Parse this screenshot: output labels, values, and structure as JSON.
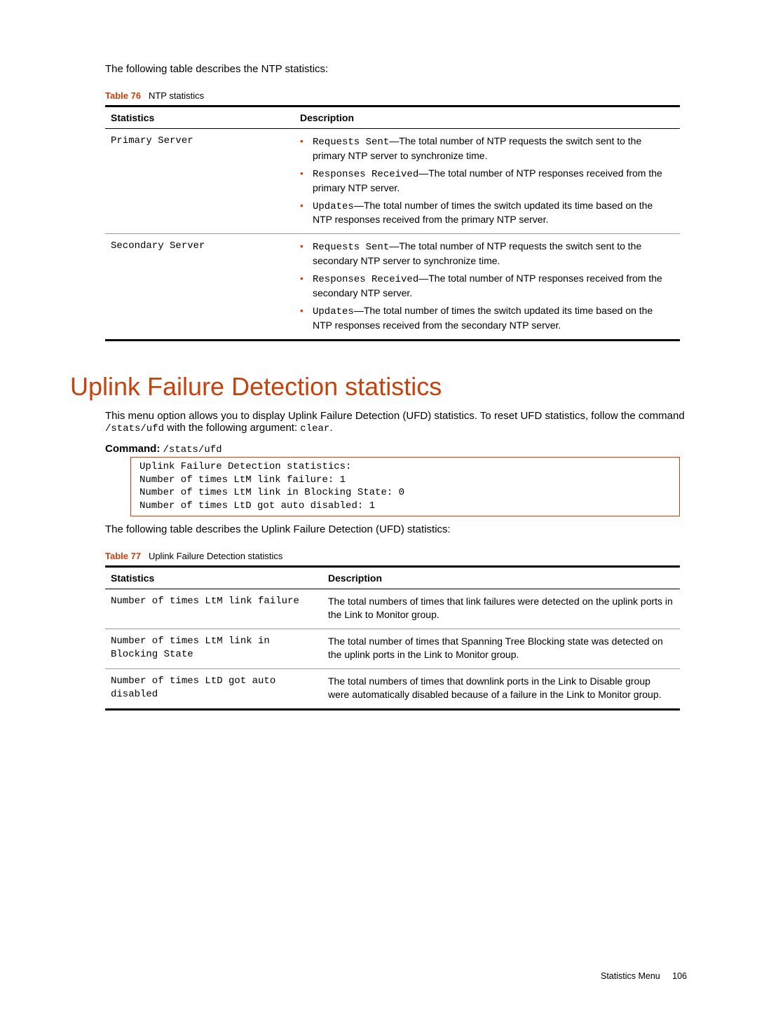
{
  "intro1": "The following table describes the NTP statistics:",
  "table76": {
    "label": "Table 76",
    "title": "NTP statistics",
    "headers": {
      "c1": "Statistics",
      "c2": "Description"
    },
    "rows": [
      {
        "stat": "Primary Server",
        "items": [
          {
            "code": "Requests Sent",
            "text": "—The total number of NTP requests the switch sent to the primary NTP server to synchronize time."
          },
          {
            "code": "Responses Received",
            "text": "—The total number of NTP responses received from the primary NTP server."
          },
          {
            "code": "Updates",
            "text": "—The total number of times the switch updated its time based on the NTP responses received from the primary NTP server."
          }
        ]
      },
      {
        "stat": "Secondary Server",
        "items": [
          {
            "code": "Requests Sent",
            "text": "—The total number of NTP requests the switch sent to the secondary NTP server to synchronize time."
          },
          {
            "code": "Responses Received",
            "text": "—The total number of NTP responses received from the secondary NTP server."
          },
          {
            "code": "Updates",
            "text": "—The total number of times the switch updated its time based on the NTP responses received from the secondary NTP server."
          }
        ]
      }
    ]
  },
  "section_heading": "Uplink Failure Detection statistics",
  "section_para_a": "This menu option allows you to display Uplink Failure Detection (UFD) statistics. To reset UFD statistics, follow the command ",
  "section_para_code": "/stats/ufd",
  "section_para_b": " with the following argument: ",
  "section_para_code2": "clear",
  "section_para_c": ".",
  "cmd_label": "Command:",
  "cmd_path": "/stats/ufd",
  "code_block": "Uplink Failure Detection statistics:\nNumber of times LtM link failure: 1\nNumber of times LtM link in Blocking State: 0\nNumber of times LtD got auto disabled: 1",
  "intro2": "The following table describes the Uplink Failure Detection (UFD) statistics:",
  "table77": {
    "label": "Table 77",
    "title": "Uplink Failure Detection statistics",
    "headers": {
      "c1": "Statistics",
      "c2": "Description"
    },
    "rows": [
      {
        "stat": "Number of times LtM link failure",
        "desc": "The total numbers of times that link failures were detected on the uplink ports in the Link to Monitor group."
      },
      {
        "stat": "Number of times LtM link in Blocking State",
        "desc": "The total number of times that Spanning Tree Blocking state was detected on the uplink ports in the Link to Monitor group."
      },
      {
        "stat": "Number of times LtD got auto disabled",
        "desc": "The total numbers of times that downlink ports in the Link to Disable group were automatically disabled because of a failure in the Link to Monitor group."
      }
    ]
  },
  "footer": {
    "section": "Statistics Menu",
    "page": "106"
  }
}
